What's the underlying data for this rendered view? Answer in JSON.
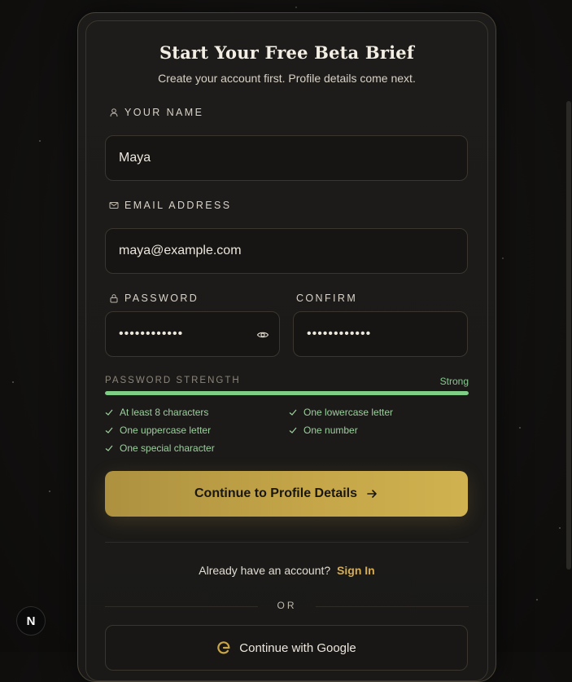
{
  "form": {
    "title": "Start Your Free Beta Brief",
    "subtitle": "Create your account first. Profile details come next.",
    "name_label": "YOUR NAME",
    "name_value": "Maya",
    "email_label": "EMAIL ADDRESS",
    "email_value": "maya@example.com",
    "password_label": "PASSWORD",
    "password_value": "••••••••••••",
    "confirm_label": "CONFIRM",
    "confirm_value": "••••••••••••"
  },
  "strength": {
    "label": "PASSWORD STRENGTH",
    "value": "Strong",
    "level": 1.0,
    "color": "#7fce86"
  },
  "requirements": [
    {
      "text": "At least 8 characters",
      "met": true
    },
    {
      "text": "One lowercase letter",
      "met": true
    },
    {
      "text": "One uppercase letter",
      "met": true
    },
    {
      "text": "One number",
      "met": true
    },
    {
      "text": "One special character",
      "met": true
    }
  ],
  "actions": {
    "continue_label": "Continue to Profile Details",
    "signin_prompt": "Already have an account?",
    "signin_link": "Sign In",
    "or_text": "OR",
    "google_label": "Continue with Google"
  },
  "badge": {
    "letter": "N"
  },
  "icons": {
    "name": "user-icon",
    "email": "mail-icon",
    "password": "lock-icon",
    "toggle": "eye-icon",
    "arrow": "arrow-right-icon",
    "check": "check-icon",
    "google": "google-icon"
  },
  "colors": {
    "accent_gold": "#c4a548",
    "link_gold": "#d4ad55",
    "success_green": "#7fce86"
  }
}
